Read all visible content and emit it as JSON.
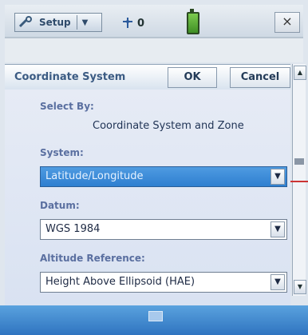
{
  "topbar": {
    "app_menu_label": "Setup",
    "satellite_count": "0",
    "close_label": "×"
  },
  "toolbar": {
    "title": "Coordinate System",
    "ok_label": "OK",
    "cancel_label": "Cancel"
  },
  "form": {
    "select_by_label": "Select By:",
    "select_by_value": "Coordinate System and Zone",
    "system_label": "System:",
    "system_value": "Latitude/Longitude",
    "datum_label": "Datum:",
    "datum_value": "WGS 1984",
    "altitude_label": "Altitude Reference:",
    "altitude_value": "Height Above Ellipsoid (HAE)"
  },
  "icons": {
    "wrench": "wrench-icon",
    "antenna": "satellite-icon",
    "battery": "battery-icon",
    "keyboard": "keyboard-icon"
  },
  "colors": {
    "selection_blue": "#2e7fd0",
    "bottom_bar": "#3a84c9",
    "label_blue": "#5a6fa0"
  }
}
